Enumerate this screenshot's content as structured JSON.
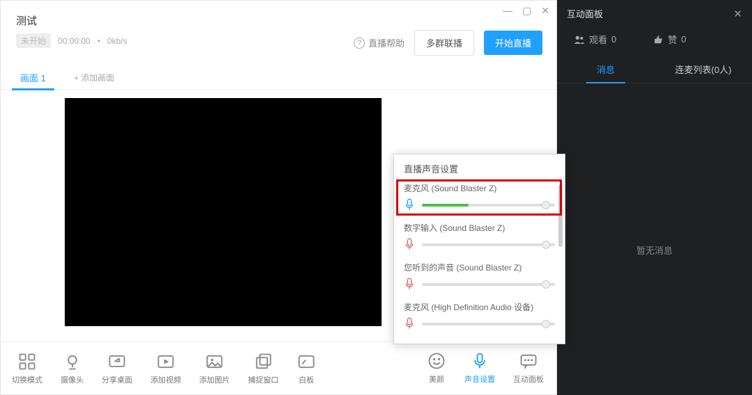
{
  "window": {
    "title": "测试",
    "status_badge": "未开始",
    "elapsed": "00:00:00",
    "bitrate": "0kb/s"
  },
  "header": {
    "help_label": "直播帮助",
    "multicast_label": "多群联播",
    "start_label": "开始直播"
  },
  "tabs": {
    "active": "画面 1",
    "add_label": "+ 添加画面"
  },
  "toolbar": {
    "switch": "切换模式",
    "camera": "摄像头",
    "share": "分享桌面",
    "video": "添加视频",
    "image": "添加图片",
    "capture": "捕捉窗口",
    "whiteboard": "白板",
    "beauty": "美颜",
    "audio": "声音设置",
    "panel": "互动面板"
  },
  "audio_popup": {
    "title": "直播声音设置",
    "devices": [
      {
        "name": "麦克风 (Sound Blaster Z)",
        "active": true,
        "level_pct": 35,
        "dot_pct": 93
      },
      {
        "name": "数字输入 (Sound Blaster Z)",
        "active": false,
        "level_pct": 0,
        "dot_pct": 93
      },
      {
        "name": "您听到的声音 (Sound Blaster Z)",
        "active": false,
        "level_pct": 0,
        "dot_pct": 93
      },
      {
        "name": "麦克风 (High Definition Audio 设备)",
        "active": false,
        "level_pct": 0,
        "dot_pct": 93
      }
    ]
  },
  "side": {
    "title": "互动面板",
    "viewers": {
      "label": "观看",
      "count": 0
    },
    "likes": {
      "label": "赞",
      "count": 0
    },
    "tab_msg": "消息",
    "tab_mic": "连麦列表(0人)",
    "empty": "暂无消息"
  }
}
